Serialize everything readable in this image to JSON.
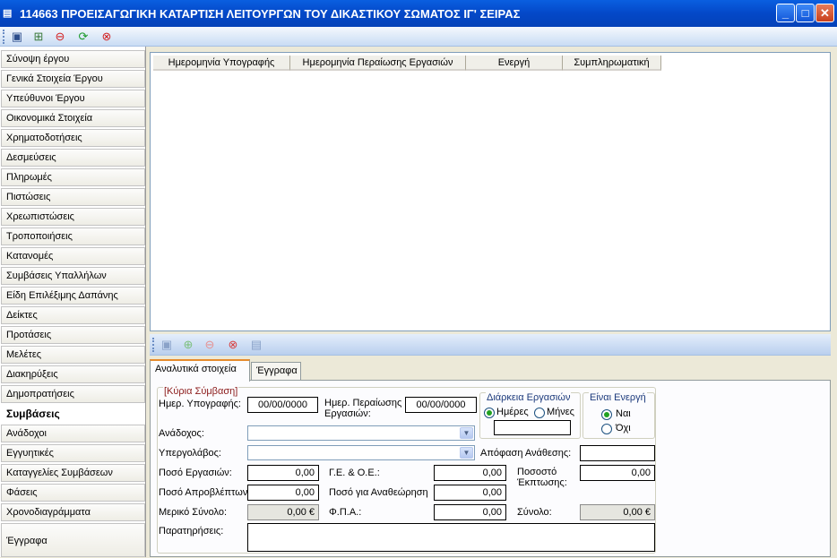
{
  "window": {
    "title": "114663 ΠΡΟΕΙΣΑΓΩΓΙΚΗ ΚΑΤΑΡΤΙΣΗ ΛΕΙΤΟΥΡΓΩΝ ΤΟΥ ΔΙΚΑΣΤΙΚΟΥ ΣΩΜΑΤΟΣ ΙΓ' ΣΕΙΡΑΣ",
    "minimize": "_",
    "maximize": "□",
    "close": "✕"
  },
  "nav": {
    "items": [
      "Σύνοψη έργου",
      "Γενικά Στοιχεία Έργου",
      "Υπεύθυνοι Έργου",
      "Οικονομικά Στοιχεία",
      "Χρηματοδοτήσεις",
      "Δεσμεύσεις",
      "Πληρωμές",
      "Πιστώσεις",
      "Χρεωπιστώσεις",
      "Τροποποιήσεις",
      "Κατανομές",
      "Συμβάσεις Υπαλλήλων",
      "Είδη Επιλέξιμης Δαπάνης",
      "Δείκτες",
      "Προτάσεις",
      "Μελέτες",
      "Διακηρύξεις",
      "Δημοπρατήσεις",
      "Συμβάσεις",
      "Ανάδοχοι",
      "Εγγυητικές",
      "Καταγγελίες Συμβάσεων",
      "Φάσεις",
      "Χρονοδιαγράμματα",
      "Έγγραφα"
    ],
    "active_index": 18
  },
  "grid": {
    "columns": [
      "Ημερομηνία Υπογραφής",
      "Ημερομηνία Περαίωσης Εργασιών",
      "Ενεργή",
      "Συμπληρωματική"
    ]
  },
  "tabs": [
    "Αναλυτικά στοιχεία",
    "Έγγραφα"
  ],
  "form": {
    "group_title": "[Κύρια Σύμβαση]",
    "sign_date_label": "Ημερ. Υπογραφής:",
    "sign_date": "00/00/0000",
    "end_date_label": "Ημερ. Περαίωσης Εργασιών:",
    "end_date": "00/00/0000",
    "duration_title": "Διάρκεια Εργασιών",
    "days": "Ημέρες",
    "months": "Μήνες",
    "active_title": "Είναι Ενεργή",
    "yes": "Ναι",
    "no": "Όχι",
    "contractor_label": "Ανάδοχος:",
    "subcontractor_label": "Υπεργολάβος:",
    "award_decision_label": "Απόφαση Ανάθεσης:",
    "works_amount_label": "Ποσό Εργασιών:",
    "works_amount": "0,00",
    "ge_oe_label": "Γ.Ε. & Ο.Ε.:",
    "ge_oe": "0,00",
    "discount_label": "Ποσοστό Έκπτωσης:",
    "discount": "0,00",
    "contingency_label": "Ποσό Απροβλέπτων",
    "contingency": "0,00",
    "revision_label": "Ποσό για Αναθεώρηση",
    "revision": "0,00",
    "partial_total_label": "Μερικό Σύνολο:",
    "partial_total": "0,00 €",
    "vat_label": "Φ.Π.Α.:",
    "vat": "0,00",
    "total_label": "Σύνολο:",
    "total": "0,00 €",
    "notes_label": "Παρατηρήσεις:"
  }
}
